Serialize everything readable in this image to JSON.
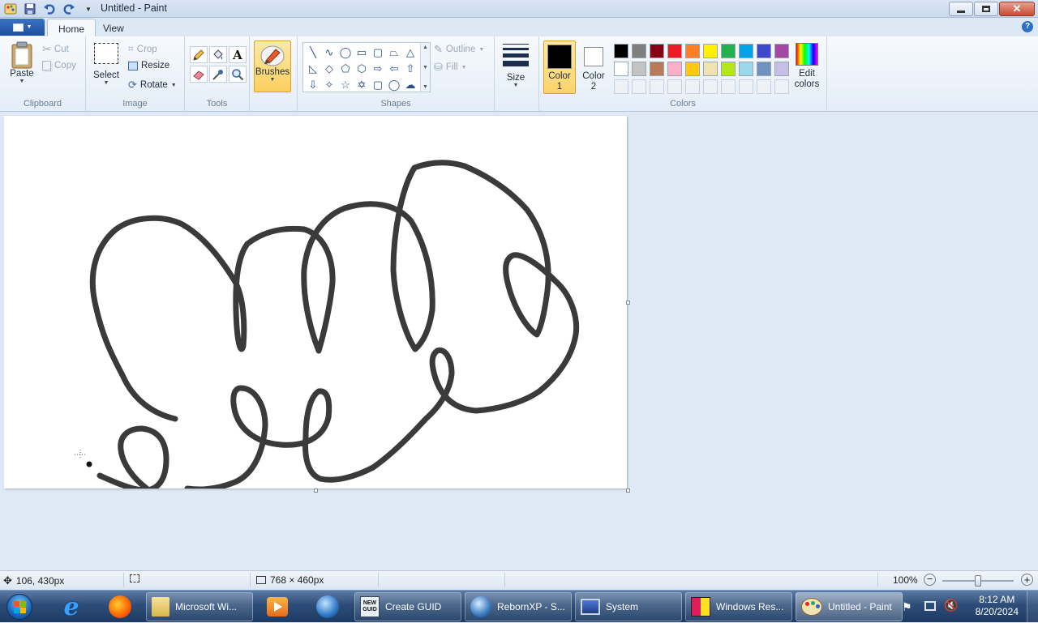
{
  "window": {
    "title": "Untitled - Paint"
  },
  "tabs": [
    {
      "label": "Home"
    },
    {
      "label": "View"
    }
  ],
  "ribbon": {
    "clipboard": {
      "group_label": "Clipboard",
      "paste": "Paste",
      "cut": "Cut",
      "copy": "Copy"
    },
    "image": {
      "group_label": "Image",
      "select": "Select",
      "crop": "Crop",
      "resize": "Resize",
      "rotate": "Rotate"
    },
    "tools": {
      "group_label": "Tools"
    },
    "brushes": {
      "label": "Brushes"
    },
    "shapes": {
      "group_label": "Shapes",
      "outline": "Outline",
      "fill": "Fill"
    },
    "size": {
      "label": "Size"
    },
    "colors": {
      "group_label": "Colors",
      "color1_label": "Color",
      "color1_num": "1",
      "color1_value": "#000000",
      "color2_label": "Color",
      "color2_num": "2",
      "color2_value": "#ffffff",
      "edit_colors_line1": "Edit",
      "edit_colors_line2": "colors",
      "palette": [
        "#000000",
        "#7f7f7f",
        "#880015",
        "#ed1c24",
        "#ff7f27",
        "#fff200",
        "#22b14c",
        "#00a2e8",
        "#3f48cc",
        "#a349a4",
        "#ffffff",
        "#c3c3c3",
        "#b97a57",
        "#ffaec9",
        "#ffc90e",
        "#efe4b0",
        "#b5e61d",
        "#99d9ea",
        "#7092be",
        "#c8bfe7"
      ]
    }
  },
  "canvas": {
    "stroke_color": "#3a3a3a"
  },
  "statusbar": {
    "cursor_pos": "106, 430px",
    "canvas_size": "768 × 460px",
    "zoom": "100%",
    "zoom_fraction": 0.5
  },
  "taskbar": {
    "tasks": [
      {
        "label": "Microsoft Wi..."
      },
      {
        "label": "Create GUID"
      },
      {
        "label": "RebornXP - S..."
      },
      {
        "label": "System"
      },
      {
        "label": "Windows Res..."
      },
      {
        "label": "Untitled - Paint"
      }
    ],
    "clock_time": "8:12 AM",
    "clock_date": "8/20/2024"
  }
}
